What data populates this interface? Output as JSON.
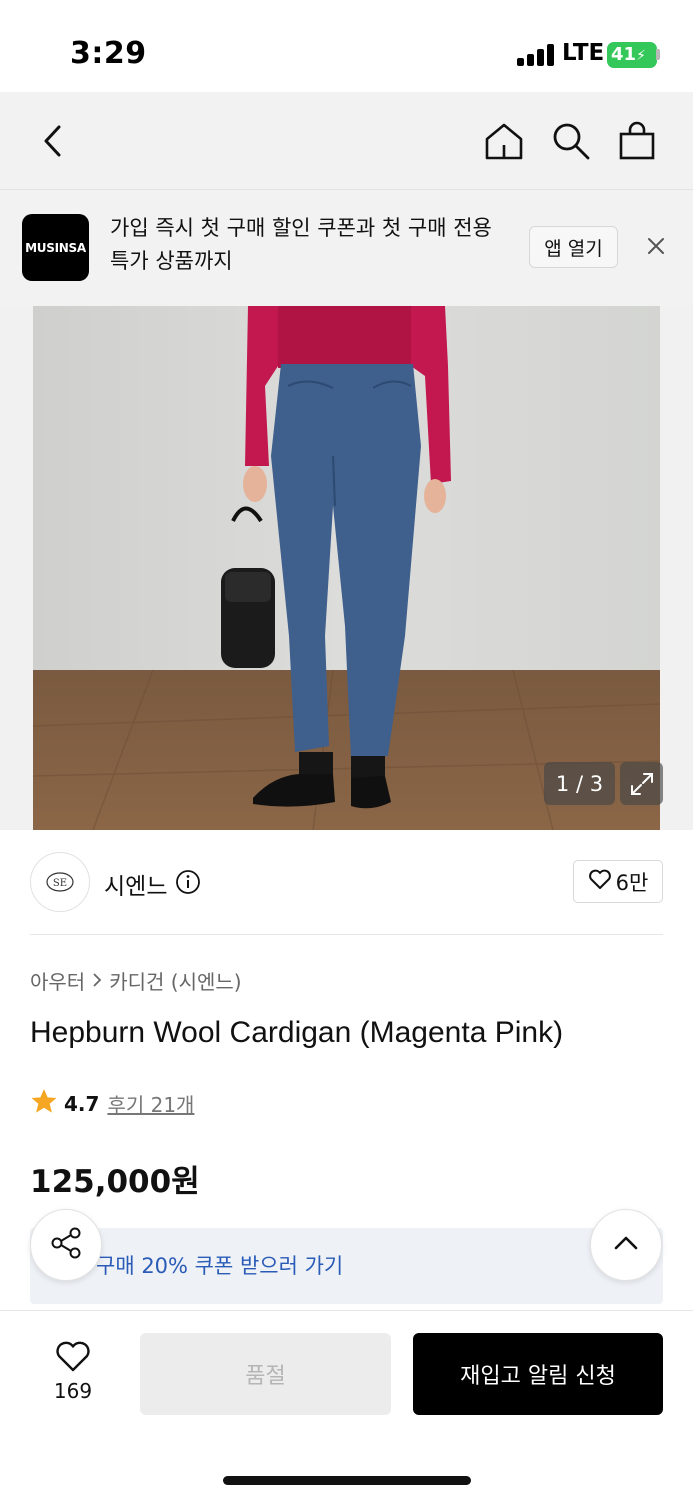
{
  "status_bar": {
    "time": "3:29",
    "network": "LTE",
    "battery": "41"
  },
  "nav": {
    "back_icon": "chevron-left-icon",
    "home_icon": "home-icon",
    "search_icon": "search-icon",
    "bag_icon": "shopping-bag-icon"
  },
  "app_banner": {
    "logo_text": "MUSINSA",
    "message": "가입 즉시 첫 구매 할인 쿠폰과 첫 구매 전용 특가 상품까지",
    "open_label": "앱 열기",
    "close_icon": "close-icon"
  },
  "gallery": {
    "page": "1 / 3",
    "expand_icon": "expand-icon"
  },
  "brand": {
    "logo_text": "SE",
    "name": "시엔느",
    "likes": "6만"
  },
  "product": {
    "breadcrumb": [
      "아우터",
      "카디건 (시엔느)"
    ],
    "title": "Hepburn Wool Cardigan (Magenta Pink)",
    "rating": "4.7",
    "reviews": "후기 21개",
    "price": "125,000원",
    "coupon_text": "구매 20% 쿠폰 받으러 가기"
  },
  "bottom_bar": {
    "wish_count": "169",
    "soldout_label": "품절",
    "restock_label": "재입고 알림 신청"
  },
  "colors": {
    "accent_blue": "#2a5bb7",
    "star": "#f5a623",
    "battery_green": "#34c759"
  }
}
